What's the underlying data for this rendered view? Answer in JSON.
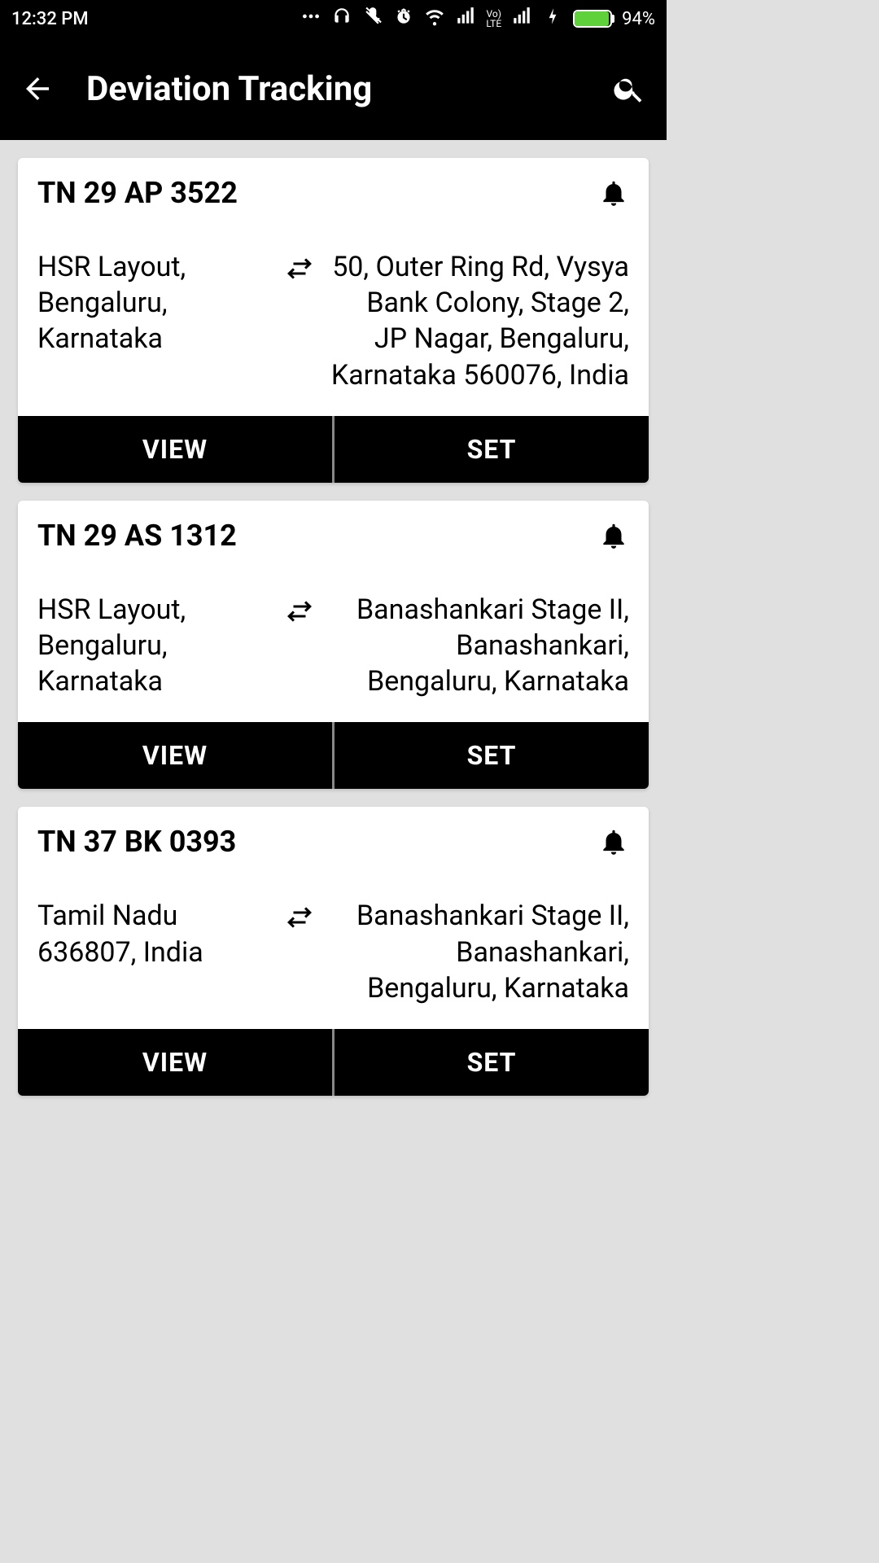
{
  "status": {
    "time": "12:32 PM",
    "battery_pct": "94%",
    "battery_fill_pct": 94
  },
  "header": {
    "title": "Deviation Tracking"
  },
  "labels": {
    "view": "VIEW",
    "set": "SET"
  },
  "cards": [
    {
      "reg": "TN 29 AP 3522",
      "from": "HSR Layout, Bengaluru, Karnataka",
      "to": "50, Outer Ring Rd, Vysya Bank Colony, Stage 2, JP Nagar, Bengaluru, Karnataka 560076, India"
    },
    {
      "reg": "TN 29 AS 1312",
      "from": "HSR Layout, Bengaluru, Karnataka",
      "to": "Banashankari Stage II, Banashankari, Bengaluru, Karnataka"
    },
    {
      "reg": "TN 37 BK 0393",
      "from": "Tamil Nadu 636807, India",
      "to": "Banashankari Stage II, Banashankari, Bengaluru, Karnataka"
    }
  ]
}
